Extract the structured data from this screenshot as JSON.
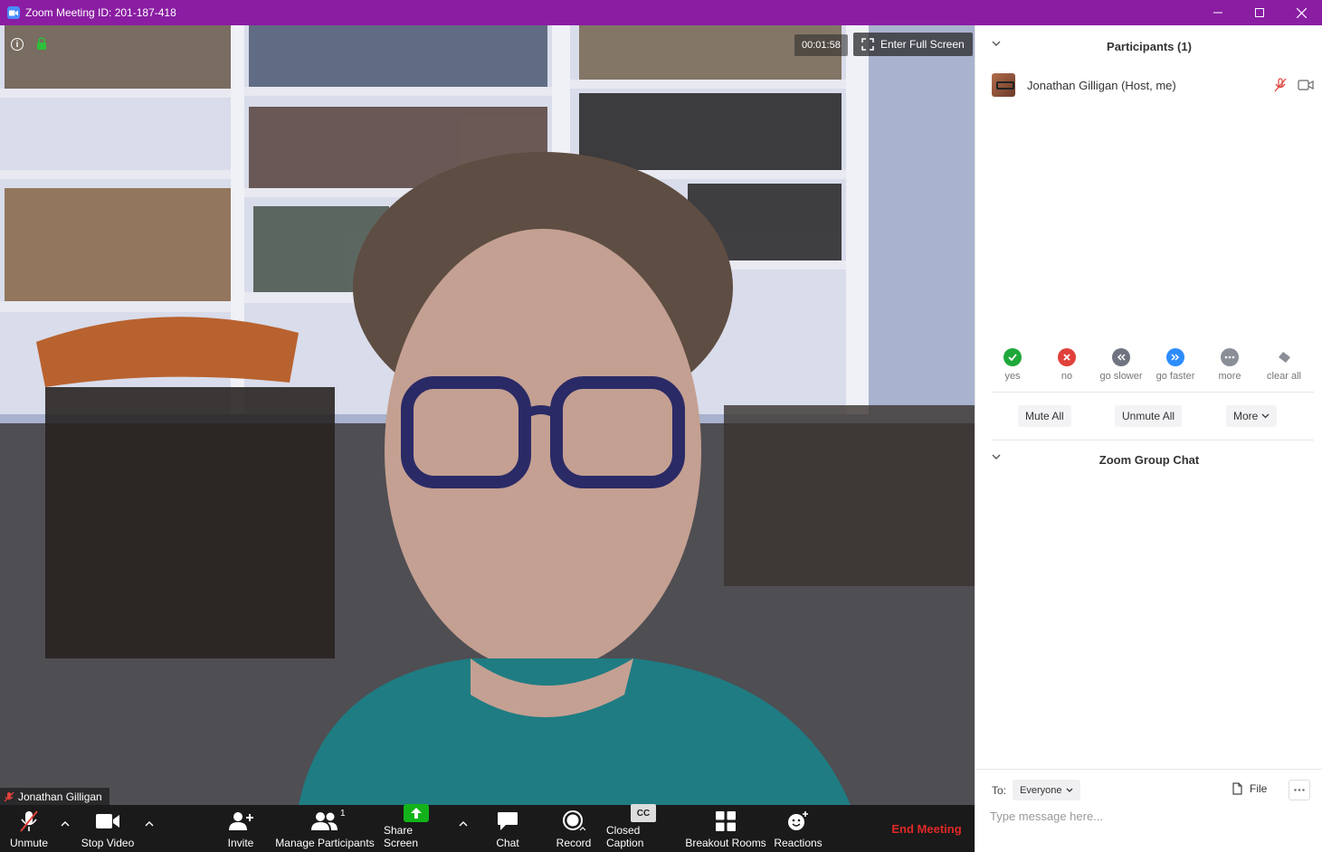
{
  "window": {
    "title": "Zoom Meeting ID: 201-187-418"
  },
  "video": {
    "timer": "00:01:58",
    "fullscreen_label": "Enter Full Screen",
    "participant_name": "Jonathan Gilligan"
  },
  "toolbar": {
    "unmute": "Unmute",
    "stop_video": "Stop Video",
    "invite": "Invite",
    "manage_participants": "Manage Participants",
    "participant_count": "1",
    "share_screen": "Share Screen",
    "chat": "Chat",
    "record": "Record",
    "closed_caption": "Closed Caption",
    "cc_glyph": "CC",
    "breakout_rooms": "Breakout Rooms",
    "reactions": "Reactions",
    "end_meeting": "End Meeting"
  },
  "participants_panel": {
    "header": "Participants (1)",
    "participants": [
      {
        "name": "Jonathan Gilligan (Host, me)",
        "muted": true
      }
    ],
    "reactions": [
      {
        "label": "yes",
        "color": "#1fa83a"
      },
      {
        "label": "no",
        "color": "#e0413a"
      },
      {
        "label": "go slower",
        "color": "#6f7480"
      },
      {
        "label": "go faster",
        "color": "#2d8cff"
      },
      {
        "label": "more",
        "color": "#8a8e96"
      },
      {
        "label": "clear all",
        "color": "#8a8e96"
      }
    ],
    "mute_all": "Mute All",
    "unmute_all": "Unmute All",
    "more": "More"
  },
  "chat_panel": {
    "header": "Zoom Group Chat",
    "to_label": "To:",
    "recipient": "Everyone",
    "file_label": "File",
    "input_placeholder": "Type message here..."
  },
  "colors": {
    "titlebar": "#8a1da2",
    "toolbar": "#1a1a1a",
    "end_meeting": "#e02828",
    "accent": "#2d8cff"
  }
}
